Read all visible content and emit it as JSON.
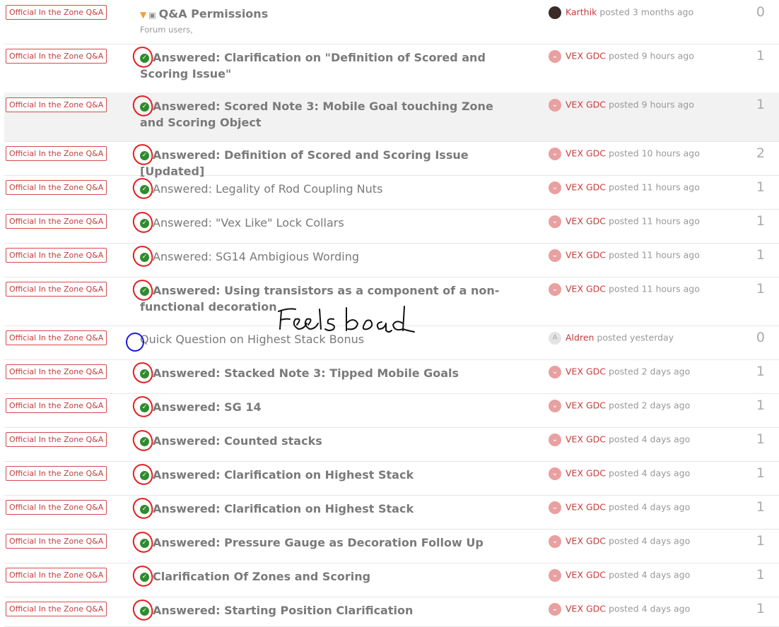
{
  "topics": [
    {
      "tag": "Official In the Zone Q&A",
      "title": "Q&A Permissions",
      "pinned": true,
      "locked": true,
      "description": "Forum users,",
      "author": "Karthik",
      "posted": "posted 3 months ago",
      "count": "0",
      "answered": false,
      "bold": true
    },
    {
      "tag": "Official In the Zone Q&A",
      "title": "Answered: Clarification on \"Definition of Scored and Scoring Issue\"",
      "author": "VEX GDC",
      "posted": "posted 9 hours ago",
      "count": "1",
      "answered": true,
      "bold": true
    },
    {
      "tag": "Official In the Zone Q&A",
      "title": "Answered: Scored Note 3: Mobile Goal touching Zone and Scoring Object",
      "author": "VEX GDC",
      "posted": "posted 9 hours ago",
      "count": "1",
      "answered": true,
      "bold": true,
      "highlighted": true
    },
    {
      "tag": "Official In the Zone Q&A",
      "title": "Answered: Definition of Scored and Scoring Issue [Updated]",
      "author": "VEX GDC",
      "posted": "posted 10 hours ago",
      "count": "2",
      "answered": true,
      "bold": true
    },
    {
      "tag": "Official In the Zone Q&A",
      "title": "Answered: Legality of Rod Coupling Nuts",
      "author": "VEX GDC",
      "posted": "posted 11 hours ago",
      "count": "1",
      "answered": true,
      "bold": false
    },
    {
      "tag": "Official In the Zone Q&A",
      "title": "Answered: \"Vex Like\" Lock Collars",
      "author": "VEX GDC",
      "posted": "posted 11 hours ago",
      "count": "1",
      "answered": true,
      "bold": false
    },
    {
      "tag": "Official In the Zone Q&A",
      "title": "Answered: SG14 Ambigious Wording",
      "author": "VEX GDC",
      "posted": "posted 11 hours ago",
      "count": "1",
      "answered": true,
      "bold": false
    },
    {
      "tag": "Official In the Zone Q&A",
      "title": "Answered: Using transistors as a component of a non-functional decoration",
      "author": "VEX GDC",
      "posted": "posted 11 hours ago",
      "count": "1",
      "answered": true,
      "bold": true
    },
    {
      "tag": "Official In the Zone Q&A",
      "title": "Quick Question on Highest Stack Bonus",
      "author": "Aldren",
      "posted": "posted yesterday",
      "count": "0",
      "answered": false,
      "bold": false,
      "avatar_letter": "A"
    },
    {
      "tag": "Official In the Zone Q&A",
      "title": "Answered: Stacked Note 3: Tipped Mobile Goals",
      "author": "VEX GDC",
      "posted": "posted 2 days ago",
      "count": "1",
      "answered": true,
      "bold": true
    },
    {
      "tag": "Official In the Zone Q&A",
      "title": "Answered: SG 14",
      "author": "VEX GDC",
      "posted": "posted 2 days ago",
      "count": "1",
      "answered": true,
      "bold": true
    },
    {
      "tag": "Official In the Zone Q&A",
      "title": "Answered: Counted stacks",
      "author": "VEX GDC",
      "posted": "posted 4 days ago",
      "count": "1",
      "answered": true,
      "bold": true
    },
    {
      "tag": "Official In the Zone Q&A",
      "title": "Answered: Clarification on Highest Stack",
      "author": "VEX GDC",
      "posted": "posted 4 days ago",
      "count": "1",
      "answered": true,
      "bold": true
    },
    {
      "tag": "Official In the Zone Q&A",
      "title": "Answered: Clarification on Highest Stack",
      "author": "VEX GDC",
      "posted": "posted 4 days ago",
      "count": "1",
      "answered": true,
      "bold": true
    },
    {
      "tag": "Official In the Zone Q&A",
      "title": "Answered: Pressure Gauge as Decoration Follow Up",
      "author": "VEX GDC",
      "posted": "posted 4 days ago",
      "count": "1",
      "answered": true,
      "bold": true
    },
    {
      "tag": "Official In the Zone Q&A",
      "title": "Clarification Of Zones and Scoring",
      "author": "VEX GDC",
      "posted": "posted 4 days ago",
      "count": "1",
      "answered": true,
      "bold": true
    },
    {
      "tag": "Official In the Zone Q&A",
      "title": "Answered: Starting Position Clarification",
      "author": "VEX GDC",
      "posted": "posted 4 days ago",
      "count": "1",
      "answered": true,
      "bold": true
    }
  ],
  "annotation": {
    "handwritten_text": "Feelsbad",
    "circle_color_answered": "#e21e1e",
    "circle_color_unanswered": "#1a1ad8"
  },
  "colors": {
    "tag_border": "#d44a4a",
    "author_link": "#c43b3b",
    "check_green": "#2e8b2e",
    "pin": "#f0a03a"
  }
}
